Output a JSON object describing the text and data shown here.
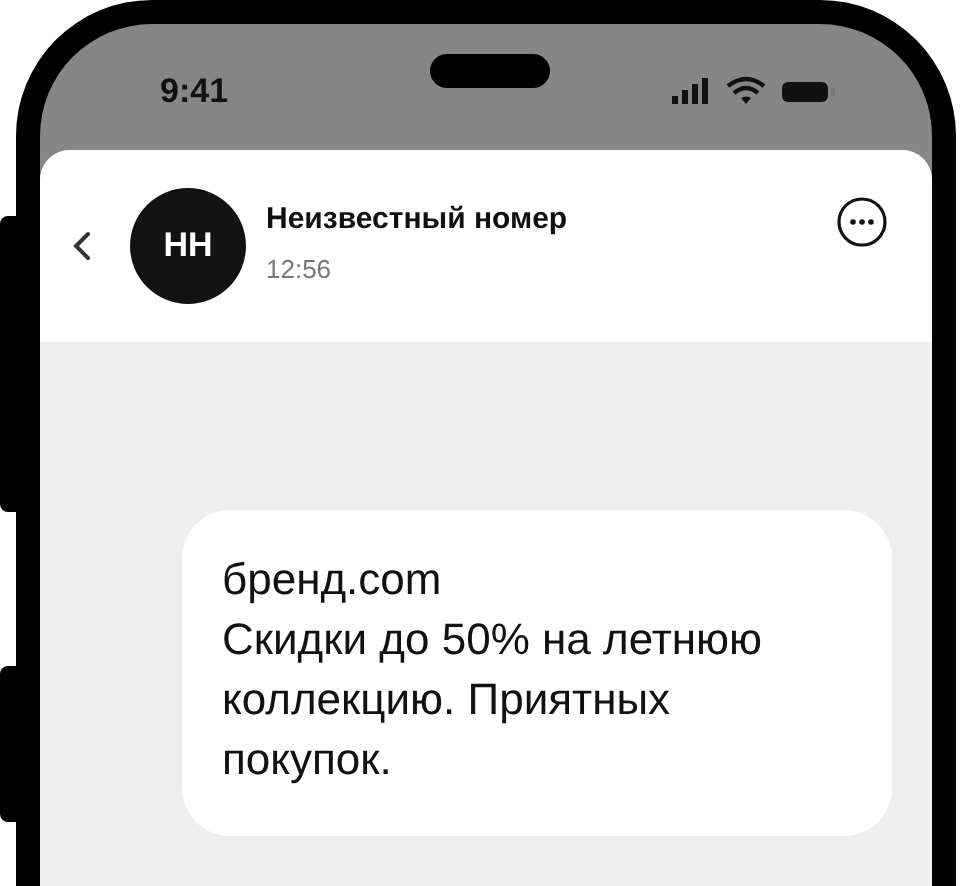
{
  "status_bar": {
    "time": "9:41"
  },
  "header": {
    "avatar_initials": "НН",
    "title": "Неизвестный номер",
    "subtitle": "12:56"
  },
  "message": {
    "sender": "бренд.com",
    "text": "Скидки до 50% на летнюю коллекцию. Приятных покупок."
  }
}
